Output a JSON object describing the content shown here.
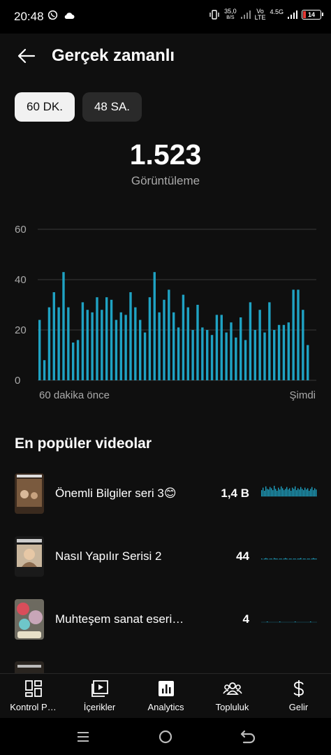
{
  "status_bar": {
    "time": "20:48",
    "network_speed_value": "35,0",
    "network_speed_unit": "B/S",
    "volte_top": "Vo",
    "volte_bottom": "LTE",
    "network_type": "4.5G",
    "battery": "14",
    "icons": [
      "whatsapp-icon",
      "cloud-icon",
      "vibrate-icon",
      "signal-icon",
      "battery-icon"
    ]
  },
  "header": {
    "title": "Gerçek zamanlı",
    "back_icon": "arrow-left-icon"
  },
  "range_chips": [
    {
      "label": "60 DK.",
      "selected": true
    },
    {
      "label": "48 SA.",
      "selected": false
    }
  ],
  "summary": {
    "value": "1.523",
    "label": "Görüntüleme"
  },
  "chart_data": {
    "type": "bar",
    "title": "",
    "xlabel_start": "60 dakika önce",
    "xlabel_end": "Şimdi",
    "yticks": [
      "60",
      "40",
      "20",
      "0"
    ],
    "ylim": [
      0,
      60
    ],
    "grid": true,
    "color": "#1fa2c3",
    "values": [
      24,
      8,
      29,
      35,
      29,
      43,
      29,
      15,
      16,
      31,
      28,
      27,
      33,
      28,
      33,
      32,
      24,
      27,
      26,
      35,
      29,
      24,
      19,
      33,
      43,
      27,
      32,
      36,
      27,
      21,
      34,
      29,
      20,
      30,
      21,
      20,
      18,
      26,
      26,
      19,
      23,
      17,
      25,
      16,
      31,
      20,
      28,
      19,
      31,
      20,
      22,
      22,
      23,
      36,
      36,
      28,
      14
    ]
  },
  "popular_videos": {
    "title": "En popüler videolar",
    "items": [
      {
        "title": "Önemli Bilgiler seri 3😊",
        "count": "1,4 B",
        "spark": [
          10,
          14,
          9,
          16,
          12,
          11,
          15,
          13,
          10,
          17,
          12,
          9,
          14,
          11,
          16,
          13,
          10,
          12,
          15,
          11,
          13,
          9,
          14,
          12,
          16,
          10,
          13,
          11,
          15,
          12,
          10,
          14,
          11,
          13,
          9,
          12,
          15,
          10,
          13,
          11
        ]
      },
      {
        "title": "Nasıl Yapılır Serisi 2",
        "count": "44",
        "spark": [
          1,
          0,
          1,
          2,
          1,
          0,
          1,
          1,
          0,
          2,
          1,
          1,
          0,
          1,
          1,
          0,
          1,
          2,
          1,
          0,
          1,
          1,
          0,
          1,
          1,
          0,
          1,
          1,
          2,
          0,
          1,
          1,
          0,
          1,
          1,
          0,
          1,
          2,
          1,
          1
        ]
      },
      {
        "title": "Muhteşem sanat eseri…",
        "count": "4",
        "spark": [
          0,
          0,
          0,
          0,
          1,
          0,
          0,
          0,
          0,
          0,
          0,
          0,
          0,
          1,
          0,
          0,
          0,
          0,
          0,
          0,
          0,
          0,
          0,
          0,
          1,
          0,
          0,
          0,
          0,
          0,
          0,
          0,
          0,
          0,
          0,
          1,
          0,
          0,
          0,
          0
        ]
      }
    ]
  },
  "bottom_nav": [
    {
      "label": "Kontrol P…",
      "icon": "dashboard-icon"
    },
    {
      "label": "İçerikler",
      "icon": "content-icon"
    },
    {
      "label": "Analytics",
      "icon": "analytics-icon"
    },
    {
      "label": "Topluluk",
      "icon": "community-icon"
    },
    {
      "label": "Gelir",
      "icon": "dollar-icon"
    }
  ],
  "system_nav": [
    "menu-icon",
    "home-icon",
    "back-icon"
  ]
}
